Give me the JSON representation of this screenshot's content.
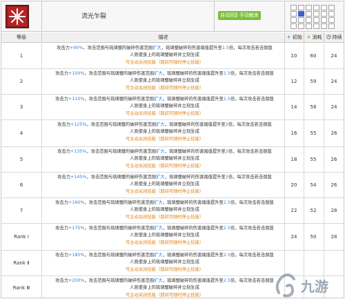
{
  "header": {
    "skill_name": "流光乍裂",
    "tag_auto": "自动回复",
    "tag_manual": "手动触发",
    "range_grid": {
      "rows": 4,
      "cols": 6,
      "self": [
        1,
        1
      ],
      "cells": [
        [
          0,
          0,
          0,
          0,
          0,
          0
        ],
        [
          0,
          2,
          0,
          0,
          0,
          0
        ],
        [
          0,
          0,
          0,
          0,
          0,
          0
        ],
        [
          0,
          0,
          0,
          0,
          0,
          0
        ]
      ]
    }
  },
  "columns": {
    "level": "等级",
    "desc": "描述",
    "initial": "初始",
    "cost": "消耗",
    "duration": "持续"
  },
  "rows": [
    {
      "level": "1",
      "atk": "+90%",
      "mult": "1.5",
      "line1_pre": "攻击力",
      "initial": "10",
      "cost": "60",
      "duration": "24"
    },
    {
      "level": "2",
      "atk": "+100%",
      "mult": "1.5",
      "line1_pre": "攻击力",
      "initial": "12",
      "cost": "59",
      "duration": "24"
    },
    {
      "level": "3",
      "atk": "+110%",
      "mult": "1.5",
      "line1_pre": "攻击力",
      "initial": "14",
      "cost": "58",
      "duration": "24"
    },
    {
      "level": "4",
      "atk": "+125%",
      "mult": "2",
      "line1_pre": "攻击力",
      "initial": "16",
      "cost": "55",
      "duration": "26"
    },
    {
      "level": "5",
      "atk": "+135%",
      "mult": "2",
      "line1_pre": "攻击力",
      "initial": "18",
      "cost": "55",
      "duration": "26"
    },
    {
      "level": "6",
      "atk": "+145%",
      "mult": "2",
      "line1_pre": "攻击力",
      "initial": "20",
      "cost": "54",
      "duration": "26"
    },
    {
      "level": "7",
      "atk": "+160%",
      "mult": "2.5",
      "line1_pre": "攻击力",
      "initial": "22",
      "cost": "52",
      "duration": "28"
    },
    {
      "level": "Rank Ⅰ",
      "atk": "+175%",
      "mult": "2.5",
      "line1_pre": "攻击力",
      "initial": "24",
      "cost": "50",
      "duration": "28"
    },
    {
      "level": "Rank Ⅱ",
      "atk": "+185%",
      "mult": "2.5",
      "line1_pre": "攻击力",
      "initial": "",
      "cost": "",
      "duration": ""
    },
    {
      "level": "Rank Ⅲ",
      "atk": "+200%",
      "mult": "2.5",
      "line1_pre": "攻击力",
      "initial": "",
      "cost": "",
      "duration": ""
    }
  ],
  "desc_parts": {
    "seg1": "，攻击范围与琉璃璧的破碎伤害范围",
    "expand": "扩大",
    "seg2": "，琉璃璧破碎的伤害阈值提升至",
    "seg3": "倍，每次攻击若击倒敌",
    "line2": "人则使身上的琉璃璧破碎并立刻生成",
    "line3_a": "可主动关闭技能",
    "line3_b": "（期间可随时停止技能）"
  },
  "watermark": "九游",
  "colors": {
    "highlight": "#2f7fd6",
    "warning": "#e0861c",
    "tag_green": "#7bbf3b",
    "range_self": "#3f5fd0",
    "icon_red": "#8b1c1c"
  }
}
